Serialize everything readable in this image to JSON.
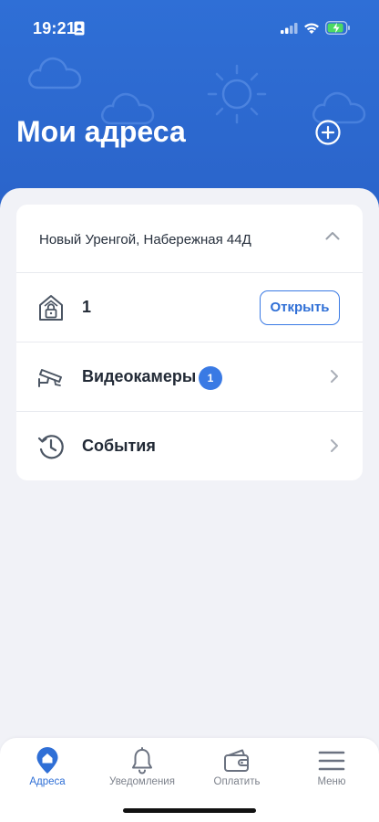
{
  "status_bar": {
    "time": "19:21"
  },
  "header": {
    "title": "Мои адреса",
    "background_color": "#2f6fd6"
  },
  "address_card": {
    "address": "Новый Уренгой, Набережная 44Д",
    "intercom": {
      "value": "1",
      "open_label": "Открыть"
    },
    "cameras": {
      "label": "Видеокамеры",
      "badge": "1"
    },
    "events": {
      "label": "События"
    }
  },
  "tab_bar": {
    "tabs": [
      {
        "label": "Адреса",
        "icon": "home-pin-icon",
        "active": true
      },
      {
        "label": "Уведомления",
        "icon": "bell-icon",
        "active": false
      },
      {
        "label": "Оплатить",
        "icon": "wallet-icon",
        "active": false
      },
      {
        "label": "Меню",
        "icon": "menu-icon",
        "active": false
      }
    ]
  },
  "colors": {
    "accent": "#2f6fd6",
    "background": "#f1f2f7",
    "inactive_tab": "#7d828c"
  }
}
